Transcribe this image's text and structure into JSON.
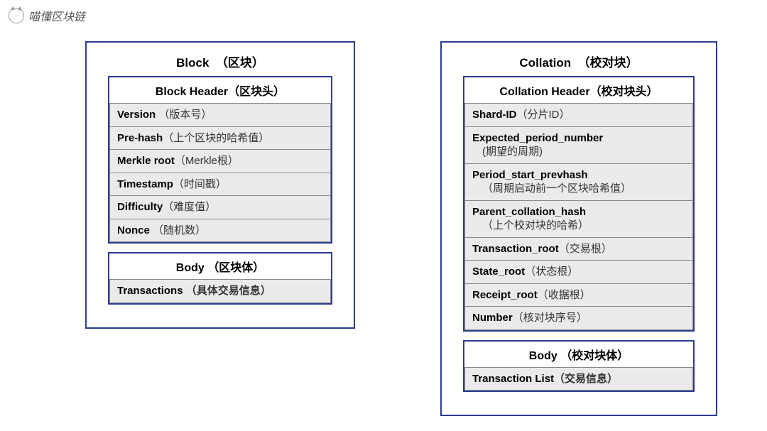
{
  "watermark": "喵懂区块链",
  "left": {
    "title_en": "Block",
    "title_cn": "（区块）",
    "header_title_en": "Block Header",
    "header_title_cn": "（区块头）",
    "header_rows": [
      {
        "en": "Version",
        "cn": "（版本号）"
      },
      {
        "en": "Pre-hash",
        "cn": "（上个区块的哈希值）"
      },
      {
        "en": "Merkle root",
        "cn": "（Merkle根）"
      },
      {
        "en": "Timestamp",
        "cn": "（时间戳）"
      },
      {
        "en": "Difficulty",
        "cn": "（难度值）"
      },
      {
        "en": "Nonce",
        "cn": "（随机数）"
      }
    ],
    "body_title_en": "Body",
    "body_title_cn": "（区块体）",
    "body_row": {
      "en": "Transactions",
      "cn": "（具体交易信息）"
    }
  },
  "right": {
    "title_en": "Collation",
    "title_cn": "（校对块）",
    "header_title_en": "Collation Header",
    "header_title_cn": "（校对块头）",
    "header_rows": [
      {
        "en": "Shard-ID",
        "cn": "（分片ID）",
        "multiline": false
      },
      {
        "en": "Expected_period_number",
        "cn": "(期望的周期)",
        "multiline": true
      },
      {
        "en": "Period_start_prevhash",
        "cn": "（周期启动前一个区块哈希值）",
        "multiline": true
      },
      {
        "en": "Parent_collation_hash",
        "cn": "（上个校对块的哈希）",
        "multiline": true
      },
      {
        "en": "Transaction_root",
        "cn": "（交易根）",
        "multiline": false
      },
      {
        "en": "State_root",
        "cn": "（状态根）",
        "multiline": false
      },
      {
        "en": "Receipt_root",
        "cn": "（收据根）",
        "multiline": false
      },
      {
        "en": "Number",
        "cn": "（核对块序号）",
        "multiline": false
      }
    ],
    "body_title_en": "Body",
    "body_title_cn": "（校对块体）",
    "body_row": {
      "en": "Transaction List",
      "cn": "（交易信息）"
    }
  }
}
